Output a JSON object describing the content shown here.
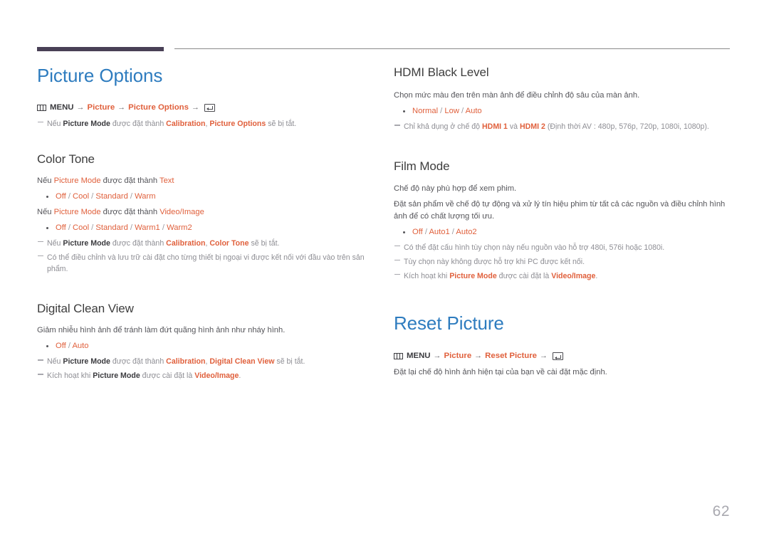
{
  "page": {
    "number": "62",
    "accent_blue": "#2e7cbf",
    "accent_orange": "#e0603c",
    "header_bar_color": "#494056",
    "body_text_color": "#55555a",
    "note_text_color": "#8e8e94"
  },
  "icons": {
    "menu_icon": "menu-grid-icon",
    "enter_icon": "enter-return-icon",
    "arrow": "→"
  },
  "left_column": {
    "title": "Picture Options",
    "menu_path": {
      "label": "MENU",
      "items": [
        "Picture",
        "Picture Options"
      ]
    },
    "intro_note": {
      "p1": "Nếu ",
      "b1": "Picture Mode",
      "p2": " được đặt thành ",
      "b2": "Calibration",
      "p3": ", ",
      "b3": "Picture Options",
      "p4": " sẽ bị tắt."
    },
    "sections": [
      {
        "heading": "Color Tone",
        "cond1": {
          "p1": "Nếu ",
          "o1": "Picture Mode",
          "p2": " được đặt thành ",
          "o2": "Text"
        },
        "options1": [
          "Off",
          "Cool",
          "Standard",
          "Warm"
        ],
        "cond2": {
          "p1": "Nếu ",
          "o1": "Picture Mode",
          "p2": " được đặt thành ",
          "o2": "Video/Image"
        },
        "options2": [
          "Off",
          "Cool",
          "Standard",
          "Warm1",
          "Warm2"
        ],
        "notes": [
          {
            "p1": "Nếu ",
            "b1": "Picture Mode",
            "p2": " được đặt thành ",
            "b2": "Calibration",
            "p3": ", ",
            "b3": "Color Tone",
            "p4": " sẽ bị tắt."
          },
          {
            "text": "Có thể điều chỉnh và lưu trữ cài đặt cho từng thiết bị ngoại vi được kết nối với đầu vào trên sản phẩm."
          }
        ]
      },
      {
        "heading": "Digital Clean View",
        "desc": "Giảm nhiễu hình ảnh để tránh làm đứt quãng hình ảnh như nháy hình.",
        "options": [
          "Off",
          "Auto"
        ],
        "notes": [
          {
            "p1": "Nếu ",
            "b1": "Picture Mode",
            "p2": " được đặt thành ",
            "b2": "Calibration",
            "p3": ", ",
            "b3": "Digital Clean View",
            "p4": " sẽ bị tắt."
          },
          {
            "p1": "Kích hoạt khi ",
            "b1": "Picture Mode",
            "p2": " được cài đặt là ",
            "b2": "Video/Image",
            "p3": "."
          }
        ]
      }
    ]
  },
  "right_column": {
    "sections": [
      {
        "heading": "HDMI Black Level",
        "desc": "Chọn mức màu đen trên màn ảnh để điều chỉnh độ sâu của màn ảnh.",
        "options": [
          "Normal",
          "Low",
          "Auto"
        ],
        "note": {
          "p1": "Chỉ khả dụng ở chế độ ",
          "b1": "HDMI 1",
          "p2": " và ",
          "b2": "HDMI 2",
          "p3": " (Định thời AV : 480p, 576p, 720p, 1080i, 1080p)."
        }
      },
      {
        "heading": "Film Mode",
        "desc1": "Chế độ này phù hợp để xem phim.",
        "desc2": "Đặt sản phẩm về chế độ tự động và xử lý tín hiệu phim từ tất cả các nguồn và điều chỉnh hình ảnh để có chất lượng tối ưu.",
        "options": [
          "Off",
          "Auto1",
          "Auto2"
        ],
        "notes": [
          {
            "text": "Có thể đặt cấu hình tùy chọn này nếu nguồn vào hỗ trợ 480i, 576i hoặc 1080i."
          },
          {
            "text": "Tùy chọn này không được hỗ trợ khi PC được kết nối."
          },
          {
            "p1": "Kích hoạt khi ",
            "b1": "Picture Mode",
            "p2": " được cài đặt là ",
            "b2": "Video/Image",
            "p3": "."
          }
        ]
      }
    ],
    "reset": {
      "title": "Reset Picture",
      "menu_path": {
        "label": "MENU",
        "items": [
          "Picture",
          "Reset Picture"
        ]
      },
      "desc": "Đặt lại chế độ hình ảnh hiện tại của bạn về cài đặt mặc định."
    }
  }
}
